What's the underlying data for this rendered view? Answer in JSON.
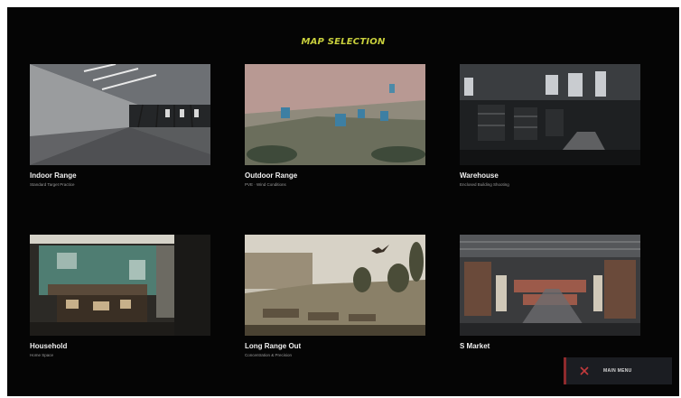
{
  "header": {
    "title": "MAP SELECTION"
  },
  "maps": [
    {
      "name": "Indoor Range",
      "subtitle": "Standard Target Practice",
      "thumbnail": "indoor-range-image"
    },
    {
      "name": "Outdoor Range",
      "subtitle": "PVE · Wind Conditions",
      "thumbnail": "outdoor-range-image"
    },
    {
      "name": "Warehouse",
      "subtitle": "Enclosed Building Shooting",
      "thumbnail": "warehouse-image"
    },
    {
      "name": "Household",
      "subtitle": "Home Space",
      "thumbnail": "household-image"
    },
    {
      "name": "Long Range Out",
      "subtitle": "Concentration & Precision",
      "thumbnail": "long-range-image"
    },
    {
      "name": "S Market",
      "subtitle": "",
      "thumbnail": "market-image"
    }
  ],
  "footer": {
    "main_menu_label": "MAIN MENU",
    "main_menu_icon": "close-icon",
    "accent_color": "#8f2a2c"
  },
  "colors": {
    "title": "#c8cf3c",
    "background": "#050505"
  }
}
